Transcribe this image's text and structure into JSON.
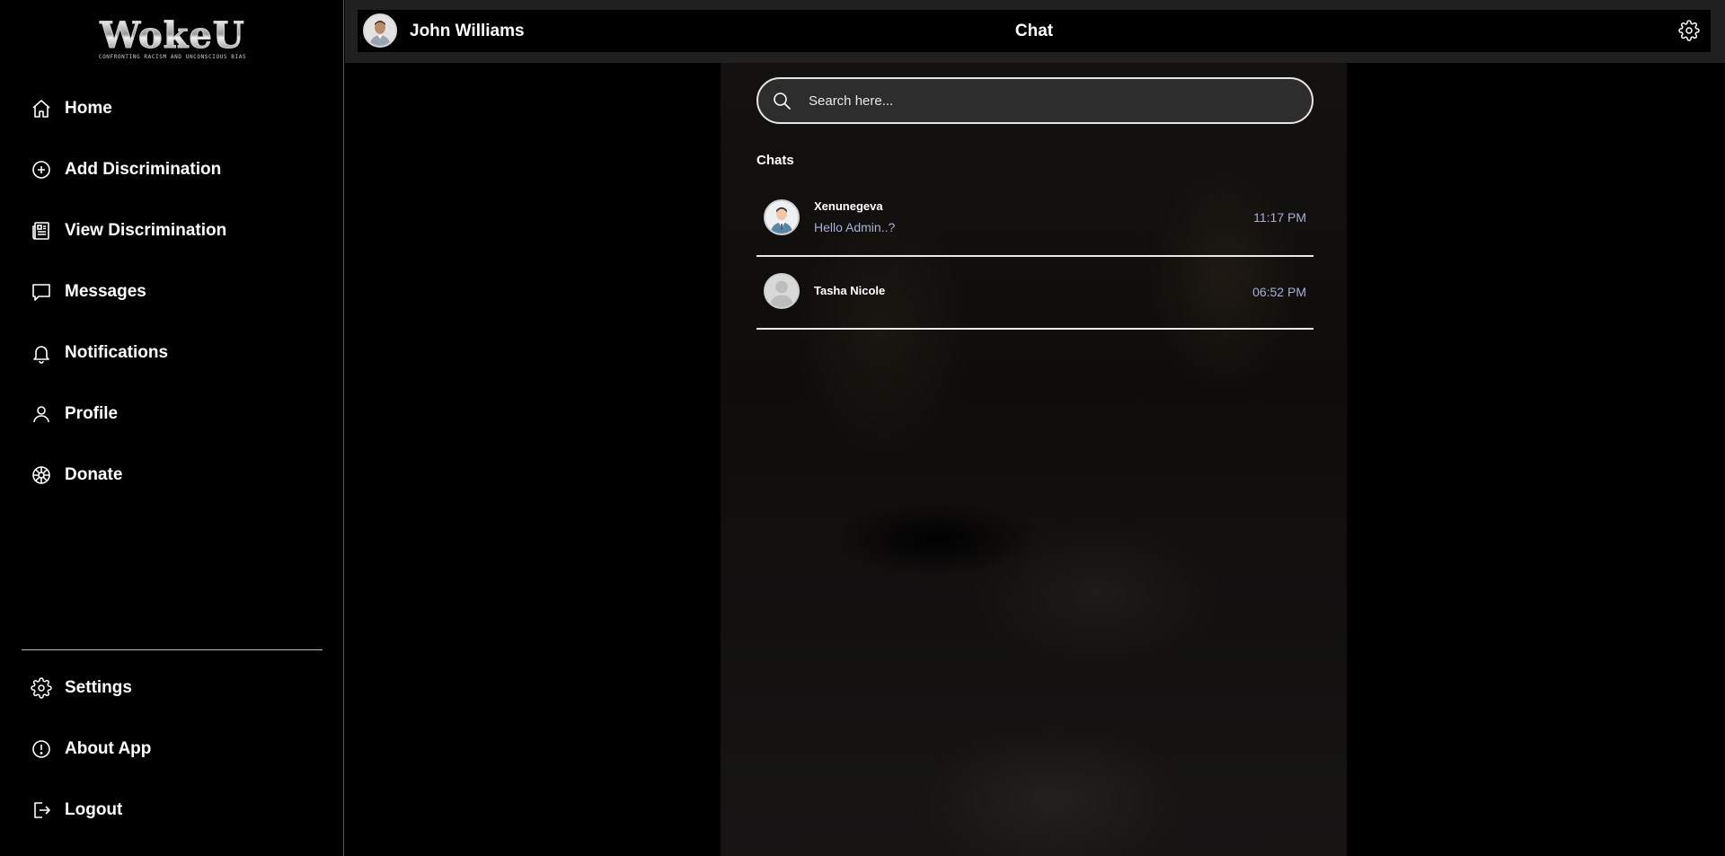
{
  "brand": {
    "logo_text": "WokeU",
    "logo_tagline": "CONFRONTING RACISM AND UNCONSCIOUS BIAS"
  },
  "sidebar": {
    "items": [
      {
        "label": "Home",
        "icon": "home-icon"
      },
      {
        "label": "Add Discrimination",
        "icon": "plus-circle-icon"
      },
      {
        "label": "View Discrimination",
        "icon": "newspaper-icon"
      },
      {
        "label": "Messages",
        "icon": "chat-bubble-icon"
      },
      {
        "label": "Notifications",
        "icon": "bell-icon"
      },
      {
        "label": "Profile",
        "icon": "user-icon"
      },
      {
        "label": "Donate",
        "icon": "donate-wheel-icon"
      }
    ],
    "bottom_items": [
      {
        "label": "Settings",
        "icon": "gear-icon"
      },
      {
        "label": "About App",
        "icon": "info-circle-icon"
      },
      {
        "label": "Logout",
        "icon": "logout-icon"
      }
    ]
  },
  "header": {
    "user_name": "John Williams",
    "title": "Chat",
    "settings_icon": "gear-icon"
  },
  "search": {
    "placeholder": "Search here...",
    "value": ""
  },
  "chats": {
    "heading": "Chats",
    "items": [
      {
        "name": "Xenunegeva",
        "last_message": "Hello Admin..?",
        "time": "11:17 PM",
        "avatar": "businessman-avatar"
      },
      {
        "name": "Tasha Nicole",
        "last_message": "",
        "time": "06:52 PM",
        "avatar": "default-avatar"
      }
    ]
  },
  "colors": {
    "background": "#000000",
    "header_strip": "#202020",
    "search_bg": "#2d2d2d",
    "meta_text": "#a7b0d6",
    "divider": "#e8e8e8"
  }
}
